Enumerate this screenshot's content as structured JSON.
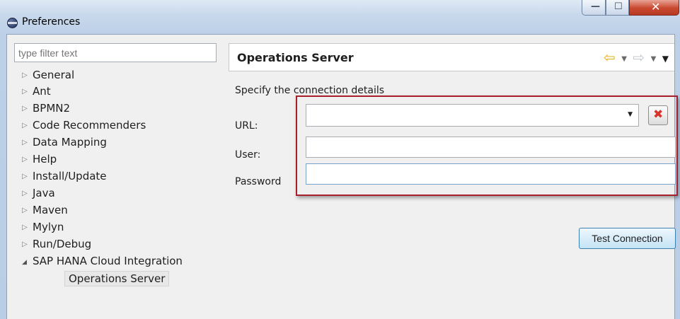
{
  "window": {
    "title": "Preferences",
    "icon": "eclipse-icon",
    "controls": {
      "minimize": "—",
      "maximize": "☐",
      "close": "✕"
    }
  },
  "filter": {
    "placeholder": "type filter text"
  },
  "tree": {
    "items": [
      {
        "label": "General",
        "expanded": false
      },
      {
        "label": "Ant",
        "expanded": false
      },
      {
        "label": "BPMN2",
        "expanded": false
      },
      {
        "label": "Code Recommenders",
        "expanded": false
      },
      {
        "label": "Data Mapping",
        "expanded": false
      },
      {
        "label": "Help",
        "expanded": false
      },
      {
        "label": "Install/Update",
        "expanded": false
      },
      {
        "label": "Java",
        "expanded": false
      },
      {
        "label": "Maven",
        "expanded": false
      },
      {
        "label": "Mylyn",
        "expanded": false
      },
      {
        "label": "Run/Debug",
        "expanded": false
      },
      {
        "label": "SAP HANA Cloud Integration",
        "expanded": true
      },
      {
        "label": "Operations Server",
        "selected": true
      }
    ]
  },
  "page": {
    "title": "Operations Server",
    "description": "Specify the connection details",
    "url_label": "URL:",
    "url_value": "",
    "user_label": "User:",
    "user_value": "",
    "password_label": "Password",
    "password_value": "",
    "test_button": "Test Connection"
  },
  "colors": {
    "highlight": "#a8202a",
    "accent_button_border": "#3c7fb1",
    "back_arrow": "#e7b21a"
  }
}
